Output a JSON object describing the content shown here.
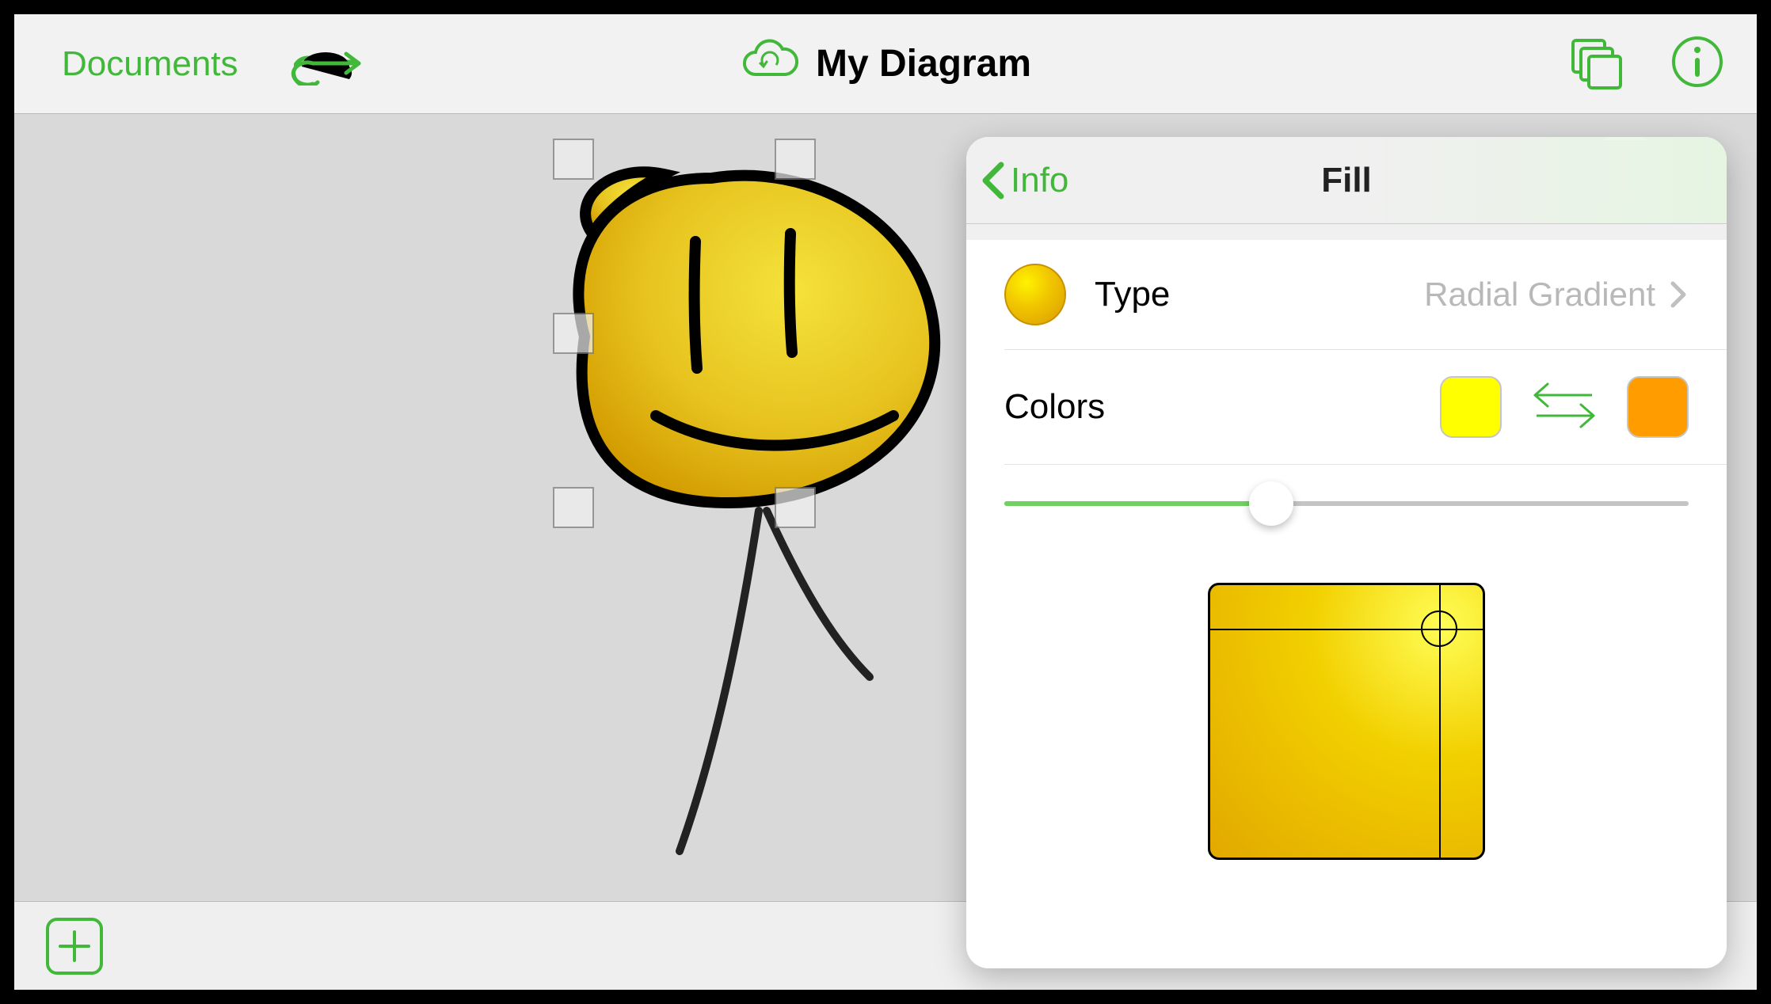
{
  "toolbar": {
    "documents_label": "Documents",
    "title": "My Diagram"
  },
  "popover": {
    "back_label": "Info",
    "title": "Fill",
    "type_label": "Type",
    "type_value": "Radial Gradient",
    "colors_label": "Colors",
    "color_from": "#ffff00",
    "color_to": "#ff9c00",
    "slider_percent": 39
  },
  "colors": {
    "accent": "#42b83b"
  }
}
